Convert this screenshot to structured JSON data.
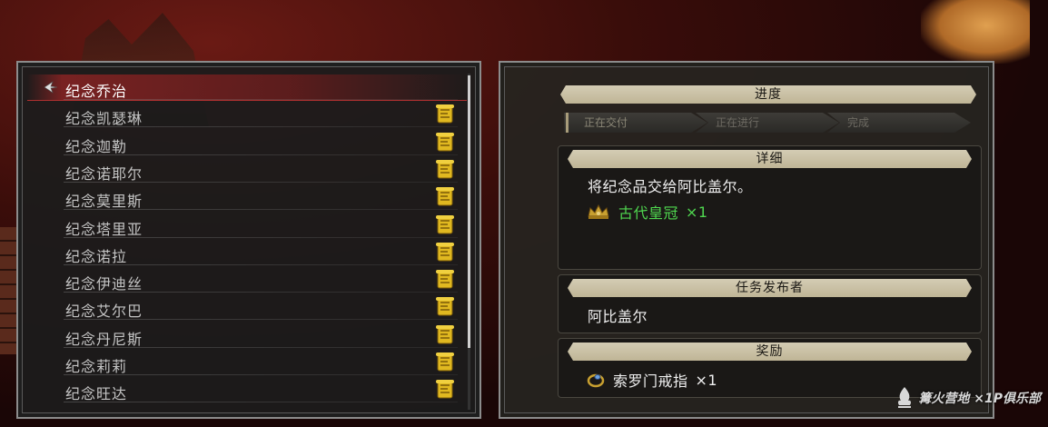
{
  "quest_list": {
    "items": [
      {
        "label": "纪念乔治",
        "selected": true,
        "has_icon": false
      },
      {
        "label": "纪念凯瑟琳",
        "selected": false,
        "has_icon": true
      },
      {
        "label": "纪念迦勒",
        "selected": false,
        "has_icon": true
      },
      {
        "label": "纪念诺耶尔",
        "selected": false,
        "has_icon": true
      },
      {
        "label": "纪念莫里斯",
        "selected": false,
        "has_icon": true
      },
      {
        "label": "纪念塔里亚",
        "selected": false,
        "has_icon": true
      },
      {
        "label": "纪念诺拉",
        "selected": false,
        "has_icon": true
      },
      {
        "label": "纪念伊迪丝",
        "selected": false,
        "has_icon": true
      },
      {
        "label": "纪念艾尔巴",
        "selected": false,
        "has_icon": true
      },
      {
        "label": "纪念丹尼斯",
        "selected": false,
        "has_icon": true
      },
      {
        "label": "纪念莉莉",
        "selected": false,
        "has_icon": true
      },
      {
        "label": "纪念旺达",
        "selected": false,
        "has_icon": true
      }
    ],
    "icon_name": "scroll-quest-icon",
    "cursor_icon": "pointer-arrow-icon"
  },
  "detail": {
    "progress_title": "进度",
    "progress_steps": [
      "正在交付",
      "正在进行",
      "完成"
    ],
    "details_title": "详细",
    "description": "将纪念品交给阿比盖尔。",
    "required_item": {
      "name": "古代皇冠",
      "qty": "×1",
      "icon": "crown-icon",
      "color": "#4fd64f"
    },
    "giver_title": "任务发布者",
    "giver_name": "阿比盖尔",
    "reward_title": "奖励",
    "reward_item": {
      "name": "索罗门戒指",
      "qty": "×1",
      "icon": "ring-icon"
    }
  },
  "watermark": {
    "text": "篝火营地 ×1P俱乐部",
    "icon": "bonfire-logo-icon"
  },
  "colors": {
    "selected_row": "#9a2424",
    "banner": "#cfc6ab",
    "quest_icon": "#e0b820",
    "item_green": "#4fd64f"
  }
}
